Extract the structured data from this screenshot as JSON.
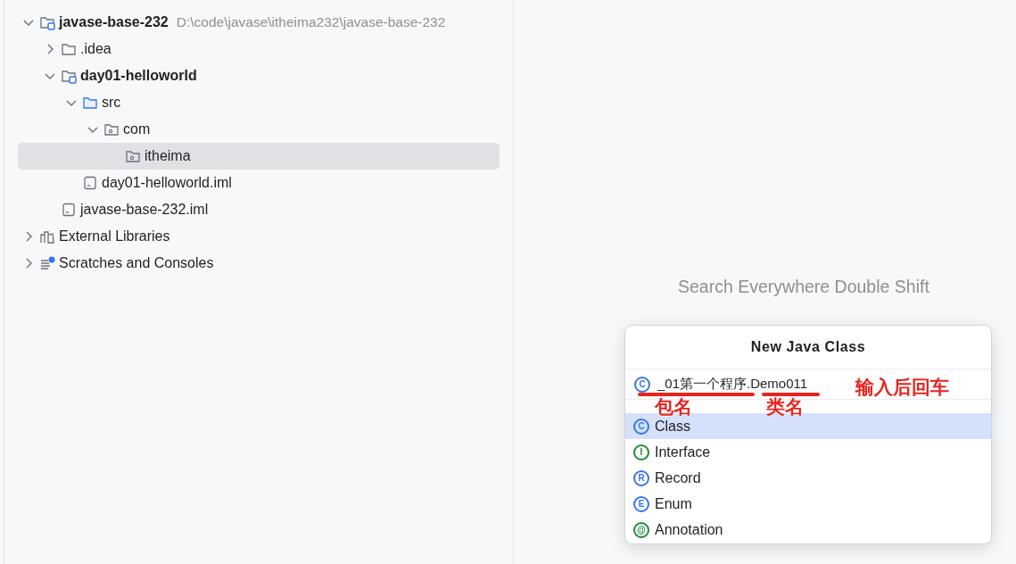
{
  "project_tree": {
    "items": [
      {
        "name": "javase-base-232",
        "kind": "module",
        "bold": true,
        "hint": "D:\\code\\javase\\itheima232\\javase-base-232",
        "expanded": true,
        "selected": false,
        "children": [
          {
            "name": ".idea",
            "kind": "folder",
            "bold": false,
            "expanded": false,
            "selected": false
          },
          {
            "name": "day01-helloworld",
            "kind": "module",
            "bold": true,
            "expanded": true,
            "selected": false,
            "children": [
              {
                "name": "src",
                "kind": "source-folder",
                "bold": false,
                "expanded": true,
                "selected": false,
                "children": [
                  {
                    "name": "com",
                    "kind": "package",
                    "bold": false,
                    "expanded": true,
                    "selected": false,
                    "children": [
                      {
                        "name": "itheima",
                        "kind": "package",
                        "bold": false,
                        "selected": true
                      }
                    ]
                  }
                ]
              },
              {
                "name": "day01-helloworld.iml",
                "kind": "file",
                "bold": false,
                "selected": false
              }
            ]
          },
          {
            "name": "javase-base-232.iml",
            "kind": "file",
            "bold": false,
            "selected": false
          }
        ]
      },
      {
        "name": "External Libraries",
        "kind": "libraries",
        "bold": false,
        "expanded": false,
        "selected": false
      },
      {
        "name": "Scratches and Consoles",
        "kind": "scratches",
        "bold": false,
        "expanded": false,
        "selected": false
      }
    ]
  },
  "editor_hint": "Search Everywhere Double Shift",
  "dialog": {
    "title": "New Java Class",
    "input": {
      "symbol": "C",
      "color": "#3574f0",
      "value": "_01第一个程序.Demo011"
    },
    "options": [
      {
        "symbol": "C",
        "color": "#3574f0",
        "label": "Class",
        "selected": true
      },
      {
        "symbol": "I",
        "color": "#208a3c",
        "label": "Interface",
        "selected": false
      },
      {
        "symbol": "R",
        "color": "#3574f0",
        "label": "Record",
        "selected": false
      },
      {
        "symbol": "E",
        "color": "#3574f0",
        "label": "Enum",
        "selected": false
      },
      {
        "symbol": "@",
        "color": "#208a3c",
        "label": "Annotation",
        "selected": false
      }
    ]
  },
  "annotations": [
    {
      "text": "包名"
    },
    {
      "text": "类名"
    },
    {
      "text": "输入后回车"
    }
  ]
}
